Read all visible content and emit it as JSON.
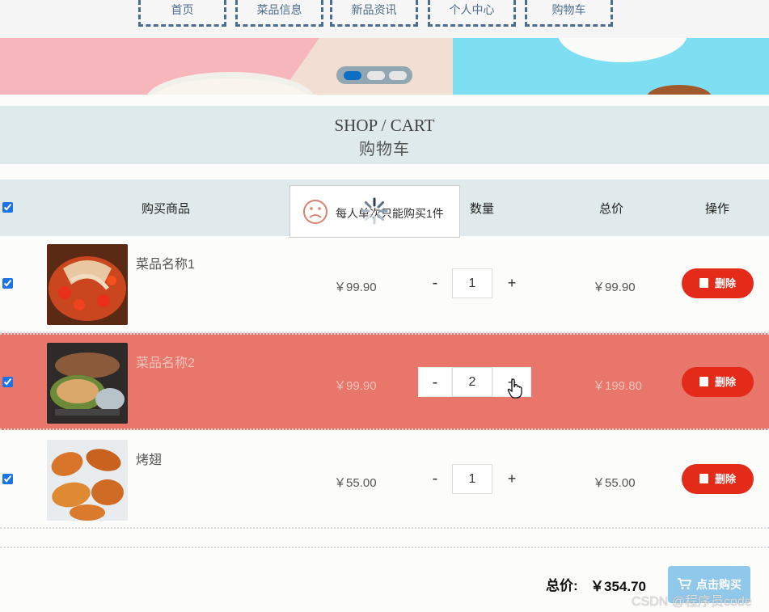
{
  "nav": [
    {
      "label": "首页"
    },
    {
      "label": "菜品信息"
    },
    {
      "label": "新品资讯"
    },
    {
      "label": "个人中心"
    },
    {
      "label": "购物车"
    }
  ],
  "banner": {
    "slide_count": 3,
    "active_slide": 1
  },
  "page_title": {
    "en": "SHOP / CART",
    "cn": "购物车"
  },
  "table": {
    "headers": {
      "product": "购买商品",
      "quantity": "数量",
      "total": "总价",
      "action": "操作"
    },
    "select_all_checked": true
  },
  "rows": [
    {
      "name": "菜品名称1",
      "price": "￥99.90",
      "qty": "1",
      "minus": "-",
      "plus": "+",
      "total": "￥99.90",
      "delete": "删除",
      "checked": true,
      "highlighted": false
    },
    {
      "name": "菜品名称2",
      "price": "￥99.90",
      "qty": "2",
      "minus": "-",
      "plus": "+",
      "total": "￥199.80",
      "delete": "删除",
      "checked": true,
      "highlighted": true
    },
    {
      "name": "烤翅",
      "price": "￥55.00",
      "qty": "1",
      "minus": "-",
      "plus": "+",
      "total": "￥55.00",
      "delete": "删除",
      "checked": true,
      "highlighted": false
    }
  ],
  "toast": {
    "message": "每人单次只能购买1件",
    "icon": "sad-face-icon"
  },
  "summary": {
    "label": "总价:",
    "value": "￥354.70"
  },
  "buy_button": {
    "label": "点击购买",
    "icon": "cart-icon"
  },
  "watermark": "CSDN @程序员code",
  "colors": {
    "highlight_row": "#e8766a",
    "delete_button": "#e42a19",
    "buy_button": "#8fc8ea",
    "nav_border": "#4a6d93",
    "title_band": "#deeaeb"
  }
}
